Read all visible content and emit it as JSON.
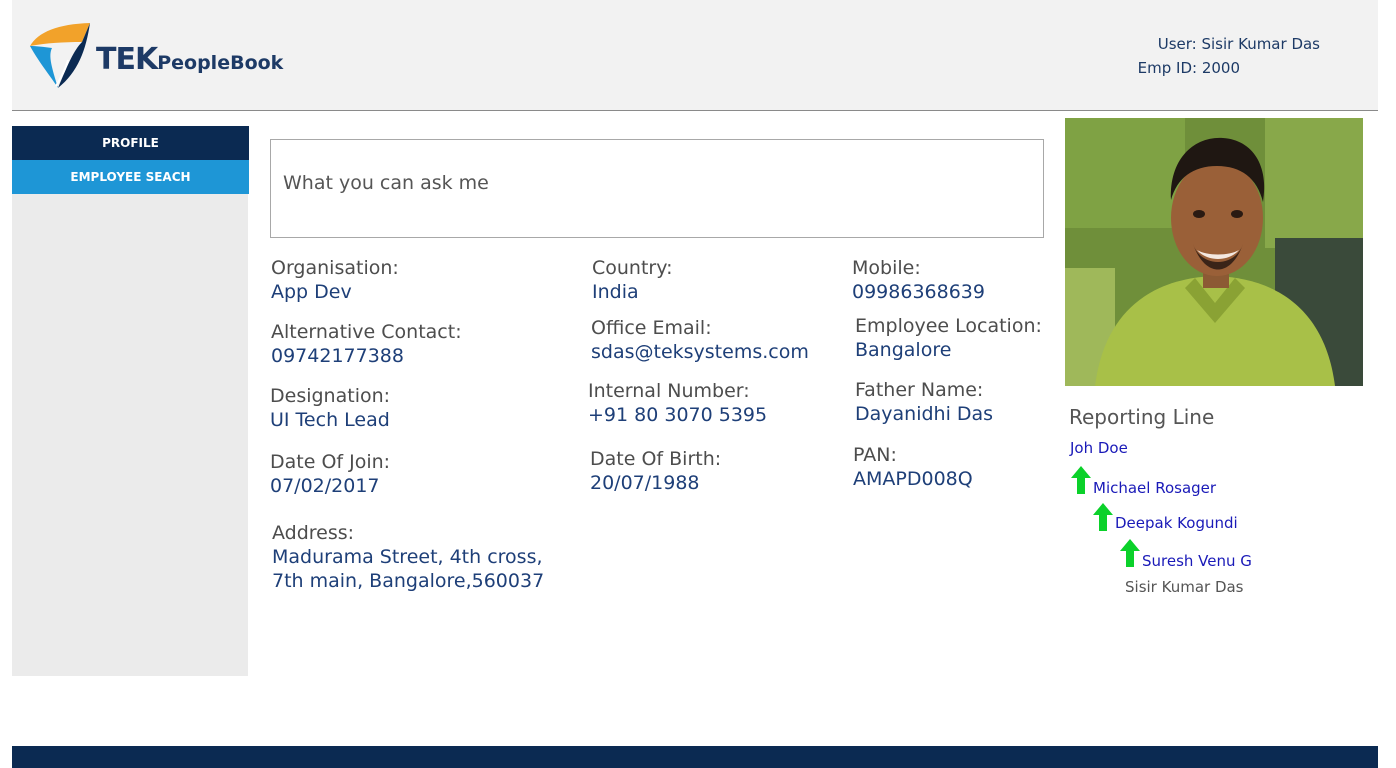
{
  "header": {
    "brand": {
      "tek": "TEK",
      "peoplebook": "PeopleBook"
    },
    "user_label": "User: Sisir Kumar Das",
    "emp_id_label": "Emp ID: 2000"
  },
  "sidebar": {
    "items": [
      {
        "label": "PROFILE",
        "active": true
      },
      {
        "label": "EMPLOYEE SEACH",
        "active": false
      }
    ]
  },
  "ask_box": {
    "text": "What you can ask me"
  },
  "profile": {
    "organisation": {
      "label": "Organisation:",
      "value": "App Dev"
    },
    "country": {
      "label": "Country:",
      "value": "India"
    },
    "mobile": {
      "label": "Mobile:",
      "value": "09986368639"
    },
    "alt_contact": {
      "label": "Alternative Contact:",
      "value": "09742177388"
    },
    "office_email": {
      "label": "Office Email:",
      "value": "sdas@teksystems.com"
    },
    "emp_location": {
      "label": "Employee Location:",
      "value": "Bangalore"
    },
    "designation": {
      "label": "Designation:",
      "value": "UI Tech Lead"
    },
    "internal_number": {
      "label": "Internal Number:",
      "value": "+91 80 3070 5395"
    },
    "father_name": {
      "label": "Father Name:",
      "value": "Dayanidhi Das"
    },
    "date_of_join": {
      "label": "Date Of Join:",
      "value": "07/02/2017"
    },
    "date_of_birth": {
      "label": "Date Of Birth:",
      "value": "20/07/1988"
    },
    "pan": {
      "label": "PAN:",
      "value": "AMAPD008Q"
    },
    "address": {
      "label": "Address:",
      "line1": "Madurama Street, 4th cross,",
      "line2": "7th main, Bangalore,560037"
    }
  },
  "reporting": {
    "title": "Reporting Line",
    "chain": [
      "Joh Doe",
      "Michael  Rosager",
      "Deepak Kogundi",
      "Suresh Venu G"
    ],
    "self": "Sisir Kumar Das"
  },
  "colors": {
    "navy": "#0b2a52",
    "accent_blue": "#1e96d6",
    "arrow_green": "#0bd12a",
    "value_blue": "#1e3f78",
    "link_blue": "#1a1ab8",
    "logo_orange": "#f2a22a"
  }
}
